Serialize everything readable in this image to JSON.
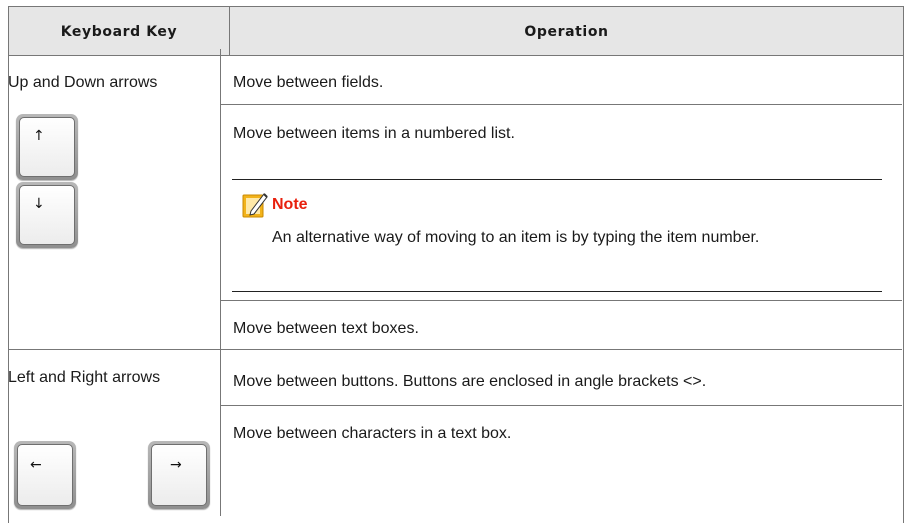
{
  "table": {
    "headers": [
      "Keyboard Key",
      "Operation"
    ],
    "rows": [
      {
        "key_label": "Up and Down arrows",
        "key_icons": [
          "arrow-up-icon",
          "arrow-down-icon"
        ],
        "operations": [
          "Move between fields.",
          "Move between items in a numbered list.",
          "Move between text boxes."
        ],
        "note": {
          "title": "Note",
          "body": "An alternative way of moving to an item is by typing the item number."
        }
      },
      {
        "key_label": "Left and Right arrows",
        "key_icons": [
          "arrow-left-icon",
          "arrow-right-icon"
        ],
        "operations": [
          "Move between buttons. Buttons are enclosed in angle brackets <>.",
          "Move between characters in a text box."
        ]
      }
    ]
  },
  "colors": {
    "header_bg": "#e6e6e6",
    "note_title": "#e8200d",
    "note_icon": "#f2b31b",
    "border": "#777777"
  }
}
